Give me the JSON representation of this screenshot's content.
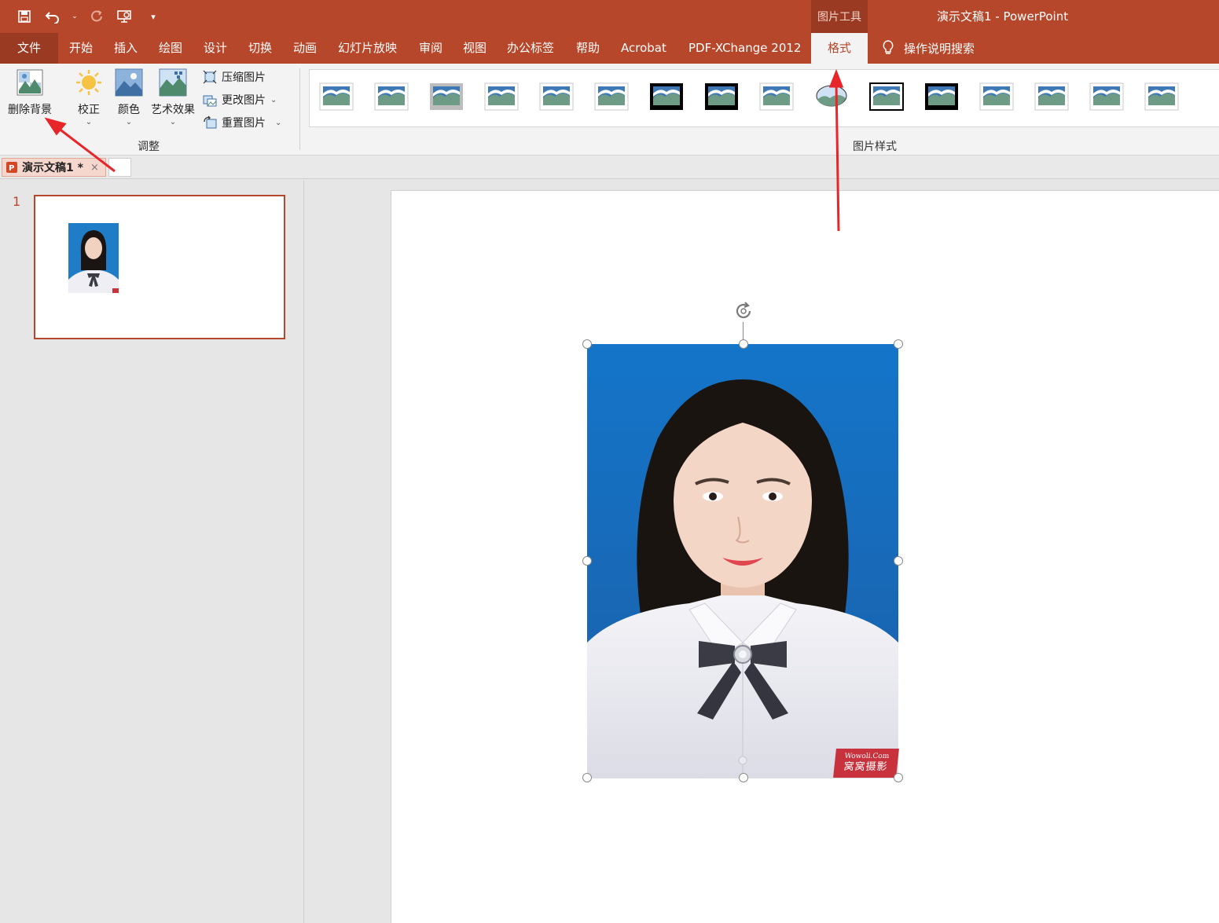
{
  "title_bar": {
    "context_group": "图片工具",
    "document_title": "演示文稿1  -  PowerPoint",
    "quick_access": [
      "save-icon",
      "undo-icon",
      "undo-dropdown-icon",
      "redo-icon",
      "present-icon",
      "customize-qat-icon"
    ]
  },
  "tabs": {
    "file": "文件",
    "items": [
      "开始",
      "插入",
      "绘图",
      "设计",
      "切换",
      "动画",
      "幻灯片放映",
      "审阅",
      "视图",
      "办公标签",
      "帮助",
      "Acrobat",
      "PDF-XChange 2012"
    ],
    "active": "格式",
    "tell_me": "操作说明搜索"
  },
  "ribbon": {
    "adjust": {
      "remove_background": "删除背景",
      "corrections": "校正",
      "color": "颜色",
      "artistic_effects": "艺术效果",
      "compress": "压缩图片",
      "change_picture": "更改图片",
      "reset_picture": "重置图片",
      "group_label": "调整"
    },
    "picture_styles": {
      "group_label": "图片样式",
      "style_count": 16
    }
  },
  "doc_tabs": {
    "name": "演示文稿1 *",
    "close": "×"
  },
  "slides_pane": {
    "slide_number": "1"
  },
  "watermark": {
    "line1": "Wowoli.Com",
    "line2": "窝窝摄影"
  },
  "colors": {
    "accent": "#b7472a",
    "photo_bg": "#1f7cc7",
    "annotation_arrow": "#e8262a"
  }
}
